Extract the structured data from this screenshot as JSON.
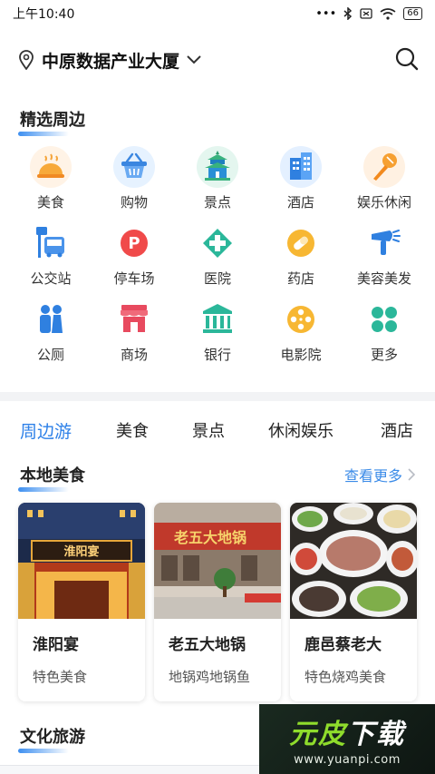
{
  "status_bar": {
    "time": "上午10:40",
    "battery": "66"
  },
  "location": {
    "name": "中原数据产业大厦"
  },
  "nearby": {
    "title": "精选周边",
    "items": [
      {
        "label": "美食",
        "icon": "food-cloche-icon"
      },
      {
        "label": "购物",
        "icon": "shopping-basket-icon"
      },
      {
        "label": "景点",
        "icon": "temple-icon"
      },
      {
        "label": "酒店",
        "icon": "hotel-building-icon"
      },
      {
        "label": "娱乐休闲",
        "icon": "microphone-icon"
      },
      {
        "label": "公交站",
        "icon": "bus-stop-icon"
      },
      {
        "label": "停车场",
        "icon": "parking-icon"
      },
      {
        "label": "医院",
        "icon": "hospital-cross-icon"
      },
      {
        "label": "药店",
        "icon": "pill-icon"
      },
      {
        "label": "美容美发",
        "icon": "hair-dryer-icon"
      },
      {
        "label": "公厕",
        "icon": "restroom-icon"
      },
      {
        "label": "商场",
        "icon": "mall-storefront-icon"
      },
      {
        "label": "银行",
        "icon": "bank-icon"
      },
      {
        "label": "电影院",
        "icon": "film-reel-icon"
      },
      {
        "label": "更多",
        "icon": "more-clover-icon"
      }
    ]
  },
  "category_tabs": [
    "周边游",
    "美食",
    "景点",
    "休闲娱乐",
    "酒店"
  ],
  "local_food": {
    "title": "本地美食",
    "see_more": "查看更多",
    "cards": [
      {
        "name": "淮阳宴",
        "tag": "特色美食",
        "sign_text": "淮阳宴"
      },
      {
        "name": "老五大地锅",
        "tag": "地锅鸡地锅鱼",
        "sign_text": "老五大地锅"
      },
      {
        "name": "鹿邑蔡老大",
        "tag": "特色烧鸡美食"
      }
    ]
  },
  "culture": {
    "title": "文化旅游"
  },
  "watermark": {
    "text_green": "元皮",
    "text_white": "下载",
    "url": "www.yuanpi.com"
  },
  "colors": {
    "accent": "#2d80e8",
    "see_more": "#3b8be8",
    "divider": "#f2f3f5"
  }
}
